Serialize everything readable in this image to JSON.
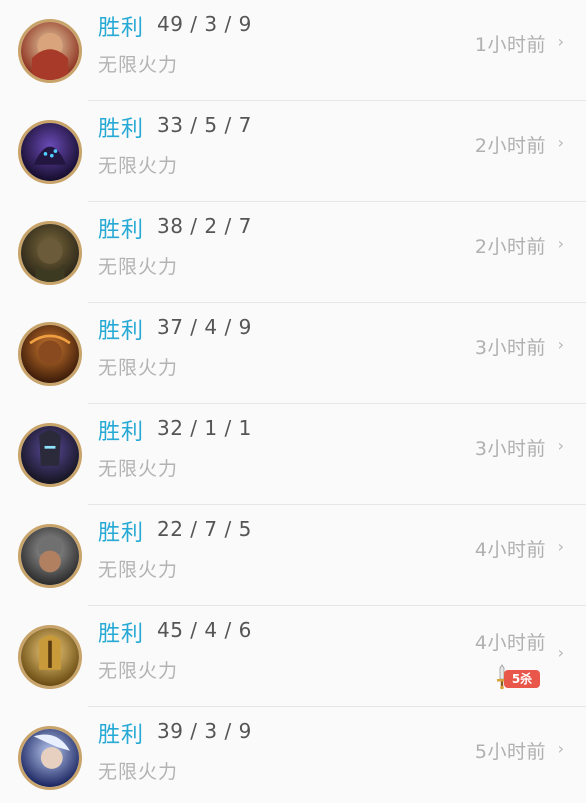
{
  "records": [
    {
      "result": "胜利",
      "kda": "49 / 3 / 9",
      "mode": "无限火力",
      "time": "1小时前",
      "avatar_icon": "champion-avatar-red-hair",
      "colors": [
        "#d8b98a",
        "#8a2c1b"
      ]
    },
    {
      "result": "胜利",
      "kda": "33 / 5 / 7",
      "mode": "无限火力",
      "time": "2小时前",
      "avatar_icon": "champion-avatar-hooded-purple",
      "colors": [
        "#2a1a4a",
        "#6b4bb8"
      ]
    },
    {
      "result": "胜利",
      "kda": "38 / 2 / 7",
      "mode": "无限火力",
      "time": "2小时前",
      "avatar_icon": "champion-avatar-dwarf-green",
      "colors": [
        "#3a3320",
        "#7b6a3b"
      ]
    },
    {
      "result": "胜利",
      "kda": "37 / 4 / 9",
      "mode": "无限火力",
      "time": "3小时前",
      "avatar_icon": "champion-avatar-fire-brown",
      "colors": [
        "#4a2410",
        "#c06a2a"
      ]
    },
    {
      "result": "胜利",
      "kda": "32 / 1 / 1",
      "mode": "无限火力",
      "time": "3小时前",
      "avatar_icon": "champion-avatar-dark-armor",
      "colors": [
        "#1b1b2a",
        "#5a4a9a"
      ]
    },
    {
      "result": "胜利",
      "kda": "22 / 7 / 5",
      "mode": "无限火力",
      "time": "4小时前",
      "avatar_icon": "champion-avatar-helmet-silver",
      "colors": [
        "#3a3a3a",
        "#8c8c8c"
      ]
    },
    {
      "result": "胜利",
      "kda": "45 / 4 / 6",
      "mode": "无限火力",
      "time": "4小时前",
      "avatar_icon": "champion-avatar-gold-helmet",
      "colors": [
        "#6a4a10",
        "#e8c46a"
      ],
      "badge": "5杀"
    },
    {
      "result": "胜利",
      "kda": "39 / 3 / 9",
      "mode": "无限火力",
      "time": "5小时前",
      "avatar_icon": "champion-avatar-archer-blue",
      "colors": [
        "#20306a",
        "#a8b8e8"
      ]
    }
  ],
  "chevron_glyph": "›",
  "colors": {
    "result": "#26a9d4",
    "kda": "#555555",
    "mode": "#b3b3b3",
    "time": "#b0b0b0",
    "badge": "#e9574b",
    "avatar_border": "#c9a46a"
  }
}
